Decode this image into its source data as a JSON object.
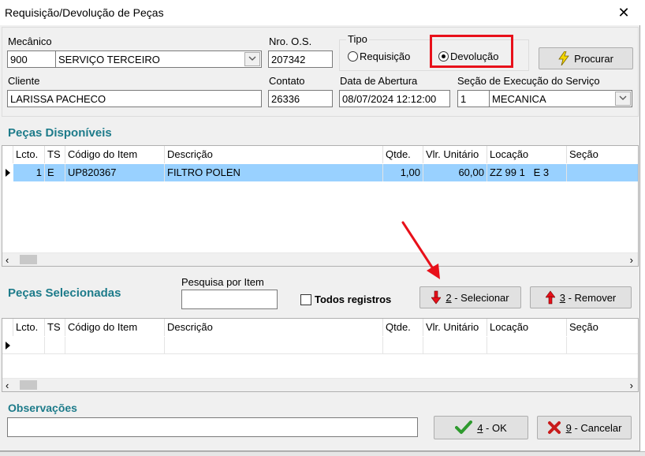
{
  "window": {
    "title": "Requisição/Devolução de Peças",
    "close_label": "✕"
  },
  "header": {
    "mecanico_label": "Mecânico",
    "mecanico_code": "900",
    "mecanico_name": "SERVIÇO TERCEIRO",
    "nro_os_label": "Nro. O.S.",
    "nro_os_value": "207342",
    "tipo_label": "Tipo",
    "tipo_options": [
      "Requisição",
      "Devolução"
    ],
    "tipo_selected": "Devolução",
    "procurar_label": "Procurar",
    "cliente_label": "Cliente",
    "cliente_value": "LARISSA PACHECO",
    "contato_label": "Contato",
    "contato_value": "26336",
    "data_abertura_label": "Data de Abertura",
    "data_abertura_value": "08/07/2024 12:12:00",
    "secao_label": "Seção de Execução do Serviço",
    "secao_code": "1",
    "secao_name": "MECANICA"
  },
  "disponiveis": {
    "title": "Peças Disponíveis",
    "columns": [
      "Lcto.",
      "TS",
      "Código do Item",
      "Descrição",
      "Qtde.",
      "Vlr. Unitário",
      "Locação",
      "Seção"
    ],
    "rows": [
      {
        "lcto": "1",
        "ts": "E",
        "codigo": "UP820367",
        "descricao": "FILTRO POLEN",
        "qtde": "1,00",
        "vlr_unitario": "60,00",
        "locacao": "ZZ 99 1   E 3",
        "secao": ""
      }
    ]
  },
  "selecionadas": {
    "title": "Peças Selecionadas",
    "pesquisa_label": "Pesquisa por Item",
    "pesquisa_value": "",
    "todos_label": "Todos registros",
    "selecionar_key": "2",
    "selecionar_label": " - Selecionar",
    "remover_key": "3",
    "remover_label": " - Remover",
    "columns": [
      "Lcto.",
      "TS",
      "Código do Item",
      "Descrição",
      "Qtde.",
      "Vlr. Unitário",
      "Locação",
      "Seção"
    ]
  },
  "observacoes": {
    "title": "Observações",
    "value": ""
  },
  "footer": {
    "ok_key": "4",
    "ok_label": " - OK",
    "cancelar_key": "9",
    "cancelar_label": " - Cancelar"
  },
  "colors": {
    "accent": "#1d7b8a",
    "selection": "#99d1ff",
    "highlight_box": "#e8101a",
    "arrow": "#e8101a"
  },
  "icons": {
    "procurar": "lightning-icon",
    "selecionar": "arrow-down-icon",
    "remover": "arrow-up-icon",
    "ok": "check-icon",
    "cancelar": "x-icon"
  }
}
